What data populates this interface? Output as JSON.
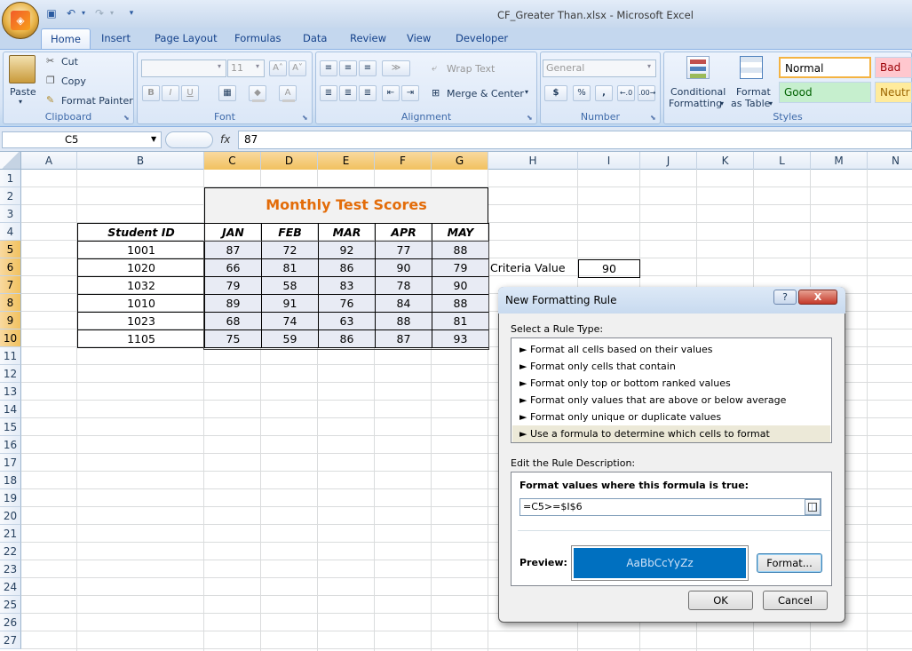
{
  "window": {
    "title": "CF_Greater Than.xlsx - Microsoft Excel"
  },
  "tabs": [
    "Home",
    "Insert",
    "Page Layout",
    "Formulas",
    "Data",
    "Review",
    "View",
    "Developer"
  ],
  "ribbon": {
    "clipboard": {
      "paste": "Paste",
      "cut": "Cut",
      "copy": "Copy",
      "format_painter": "Format Painter",
      "label": "Clipboard"
    },
    "font": {
      "size": "11",
      "label": "Font",
      "bold": "B",
      "italic": "I",
      "underline": "U"
    },
    "alignment": {
      "wrap_text": "Wrap Text",
      "merge_center": "Merge & Center",
      "label": "Alignment"
    },
    "number": {
      "format": "General",
      "currency": "$",
      "percent": "%",
      "comma": ",",
      "label": "Number"
    },
    "styles": {
      "conditional": "Conditional",
      "conditional2": "Formatting",
      "format": "Format",
      "format2": "as Table",
      "normal": "Normal",
      "bad": "Bad",
      "good": "Good",
      "neutral": "Neutr",
      "label": "Styles"
    }
  },
  "formula_bar": {
    "name_box": "C5",
    "fx": "fx",
    "value": "87"
  },
  "columns": [
    "A",
    "B",
    "C",
    "D",
    "E",
    "F",
    "G",
    "H",
    "I",
    "J",
    "K",
    "L",
    "M",
    "N"
  ],
  "rows": [
    "1",
    "2",
    "3",
    "4",
    "5",
    "6",
    "7",
    "8",
    "9",
    "10",
    "11",
    "12",
    "13",
    "14",
    "15",
    "16",
    "17",
    "18",
    "19",
    "20",
    "21",
    "22",
    "23",
    "24",
    "25",
    "26",
    "27"
  ],
  "sheet": {
    "title": "Monthly Test Scores",
    "headers": [
      "Student ID",
      "JAN",
      "FEB",
      "MAR",
      "APR",
      "MAY"
    ],
    "data": [
      [
        "1001",
        "87",
        "72",
        "92",
        "77",
        "88"
      ],
      [
        "1020",
        "66",
        "81",
        "86",
        "90",
        "79"
      ],
      [
        "1032",
        "79",
        "58",
        "83",
        "78",
        "90"
      ],
      [
        "1010",
        "89",
        "91",
        "76",
        "84",
        "88"
      ],
      [
        "1023",
        "68",
        "74",
        "63",
        "88",
        "81"
      ],
      [
        "1105",
        "75",
        "59",
        "86",
        "87",
        "93"
      ]
    ],
    "criteria_label": "Criteria Value",
    "criteria_value": "90"
  },
  "dialog": {
    "title": "New Formatting Rule",
    "help": "?",
    "close": "X",
    "select_label": "Select a Rule Type:",
    "rules": [
      "► Format all cells based on their values",
      "► Format only cells that contain",
      "► Format only top or bottom ranked values",
      "► Format only values that are above or below average",
      "► Format only unique or duplicate values",
      "► Use a formula to determine which cells to format"
    ],
    "edit_label": "Edit the Rule Description:",
    "formula_label": "Format values where this formula is true:",
    "formula": "=C5>=$I$6",
    "preview_label": "Preview:",
    "preview_text": "AaBbCcYyZz",
    "format_btn": "Format...",
    "ok": "OK",
    "cancel": "Cancel",
    "preview_color": "#0070c0"
  }
}
